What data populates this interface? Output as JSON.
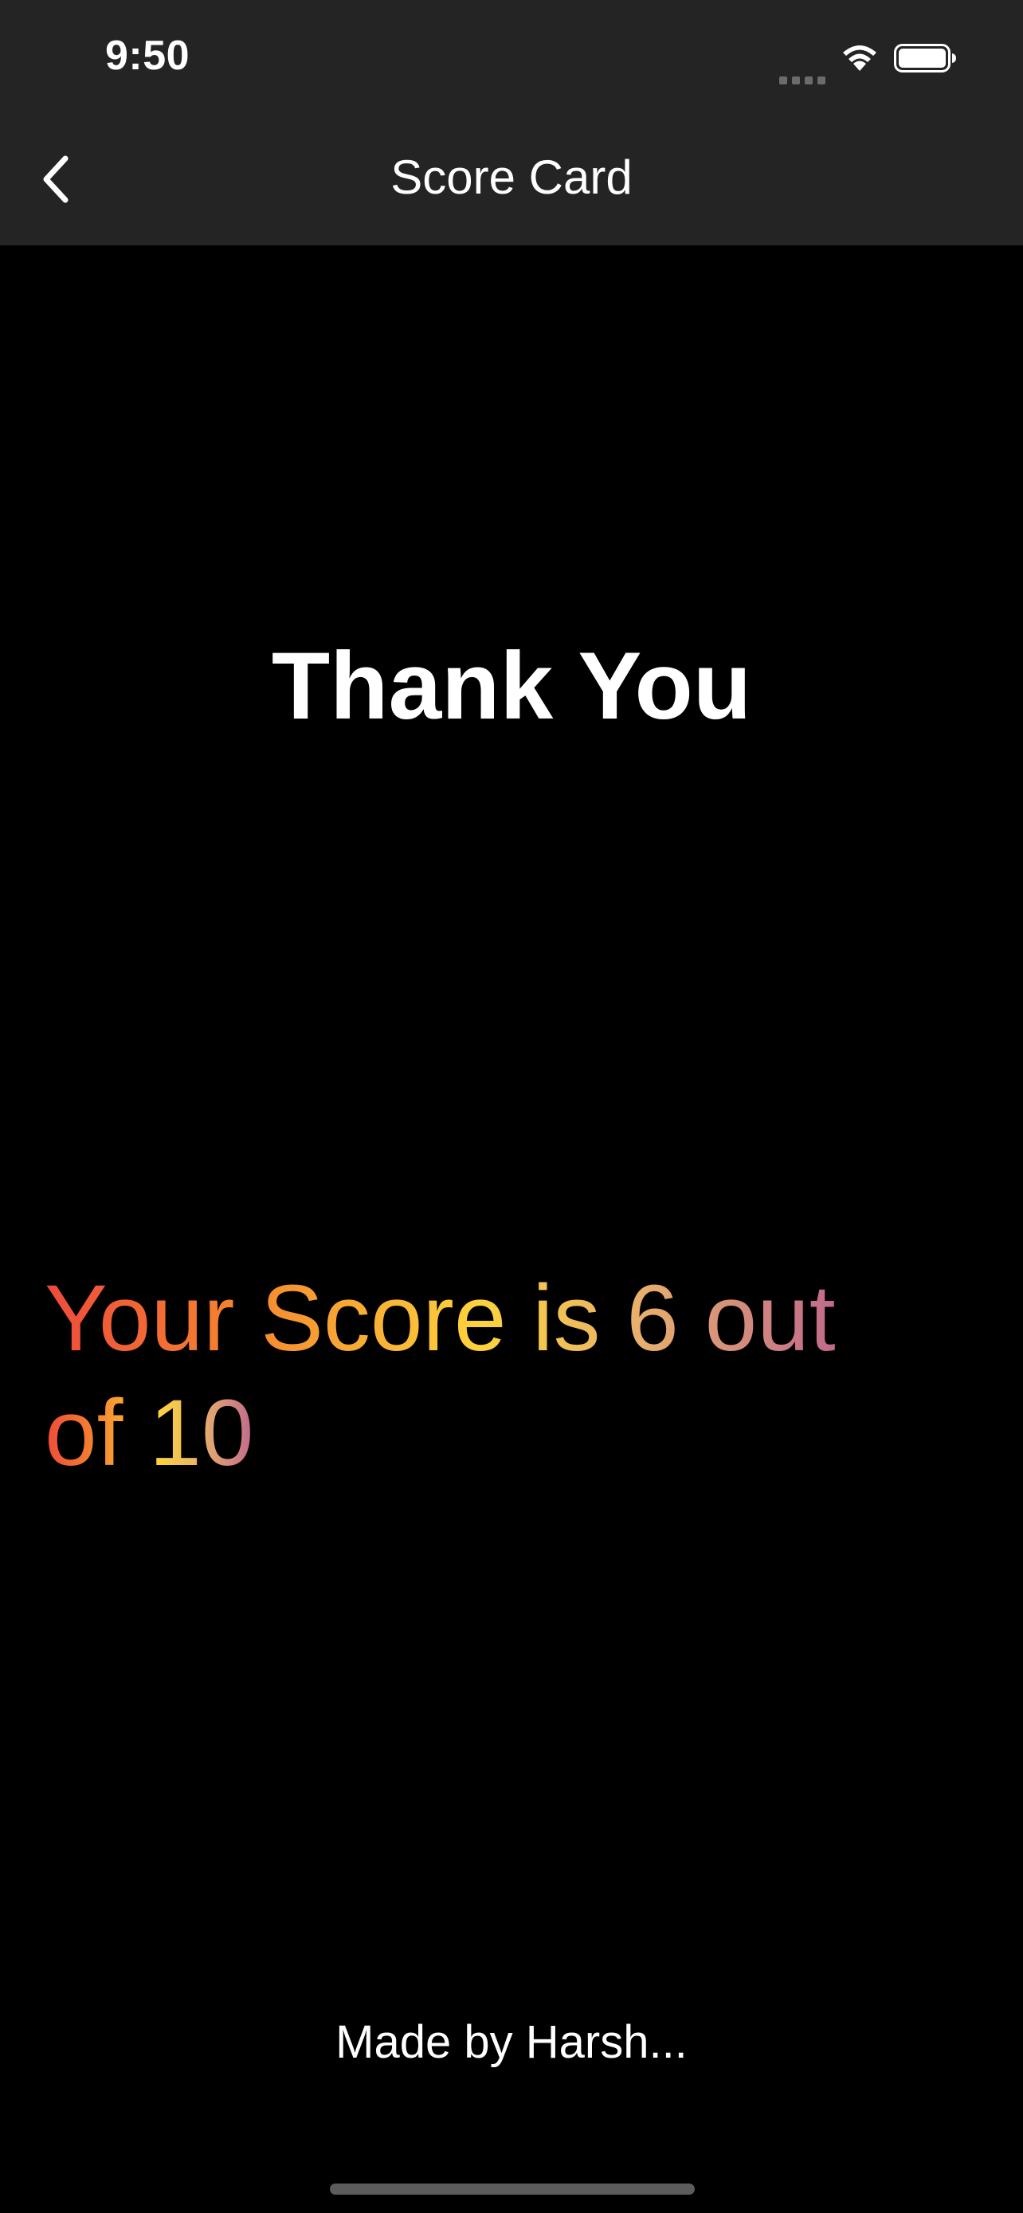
{
  "status_bar": {
    "time": "9:50",
    "icons": [
      "cellular-signal-icon",
      "wifi-icon",
      "battery-icon"
    ]
  },
  "nav": {
    "back_icon": "chevron-left-icon",
    "title": "Score Card"
  },
  "main": {
    "heading": "Thank You",
    "score_line_1": "Your Score is 6 out",
    "score_line_2": "of 10"
  },
  "footer": {
    "credit": "Made by Harsh..."
  },
  "colors": {
    "background": "#000000",
    "bar": "#242424",
    "text": "#ffffff",
    "score_gradient": [
      "#ee4a3b",
      "#f5852f",
      "#fcd33c",
      "#e8b06c",
      "#c06a8c"
    ]
  }
}
